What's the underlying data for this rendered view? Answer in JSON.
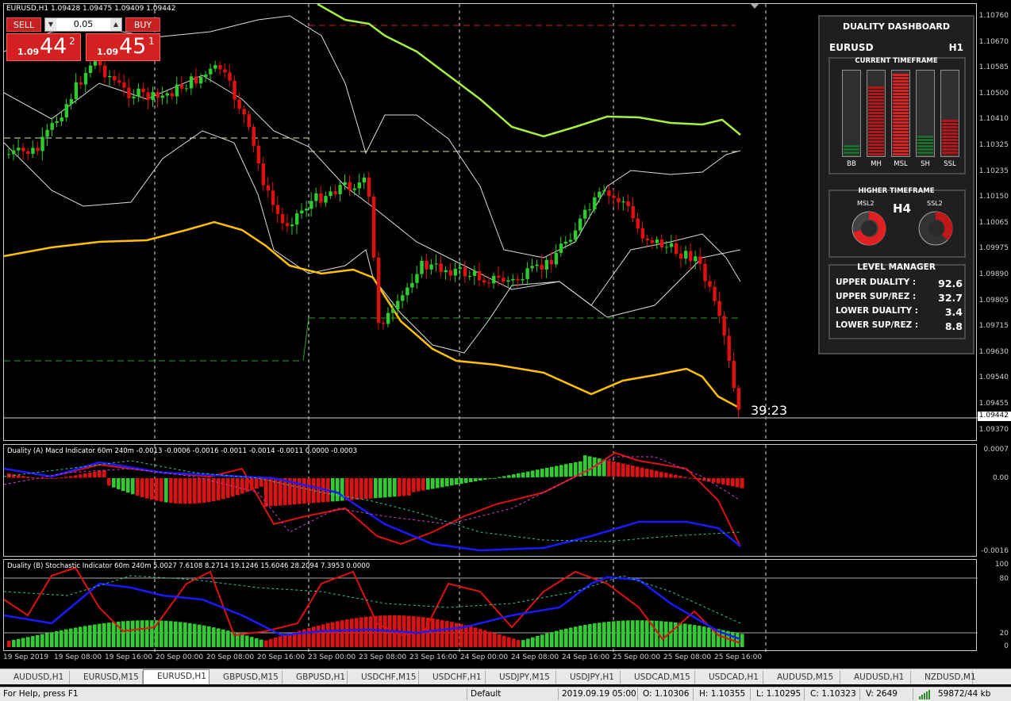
{
  "symbol_title": "EURUSD,H1  1.09428 1.09475 1.09409 1.09442",
  "trade_panel": {
    "sell_label": "SELL",
    "buy_label": "BUY",
    "lot": "0.05",
    "bid_small": "1.09",
    "bid_big": "44",
    "bid_sup": "2",
    "ask_small": "1.09",
    "ask_big": "45",
    "ask_sup": "1",
    "down_arrow": "▼",
    "up_arrow": "▲"
  },
  "countdown": "39:23",
  "price_axis": {
    "main": [
      "1.10760",
      "1.10670",
      "1.10585",
      "1.10500",
      "1.10410",
      "1.10325",
      "1.10235",
      "1.10150",
      "1.10065",
      "1.09975",
      "1.09890",
      "1.09805",
      "1.09715",
      "1.09630",
      "1.09540",
      "1.09455",
      "1.09370"
    ],
    "current_price": "1.09442",
    "macd": [
      "0.0007",
      "0.00",
      "-0.0016"
    ],
    "stoch": [
      "100",
      "80",
      "20",
      "0"
    ]
  },
  "time_axis": [
    "19 Sep 2019",
    "19 Sep 08:00",
    "19 Sep 16:00",
    "20 Sep 00:00",
    "20 Sep 08:00",
    "20 Sep 16:00",
    "23 Sep 00:00",
    "23 Sep 08:00",
    "23 Sep 16:00",
    "24 Sep 00:00",
    "24 Sep 08:00",
    "24 Sep 16:00",
    "25 Sep 00:00",
    "25 Sep 08:00",
    "25 Sep 16:00"
  ],
  "indicators": {
    "macd_title": "Duality (A) Macd Indicator 60m 240m  -0.0013 -0.0006 -0.0016 -0.0011 -0.0014 -0.0011 0.0000 -0.0003",
    "stoch_title": "Duality (B) Stochastic Indicator 60m 240m  5.0027 7.6108 8.2714 19.1246 15.6046 28.2094 7.3953 0.0000"
  },
  "dashboard": {
    "title": "DUALITY DASHBOARD",
    "symbol": "EURUSD",
    "timeframe": "H1",
    "current_tf_label": "CURRENT TIMEFRAME",
    "bars": [
      {
        "label": "BB",
        "level": 0.12,
        "color": "#1e6b2e"
      },
      {
        "label": "MH",
        "level": 0.82,
        "color": "#b01818"
      },
      {
        "label": "MSL",
        "level": 0.97,
        "color": "#d82020"
      },
      {
        "label": "SH",
        "level": 0.24,
        "color": "#1e6b2e"
      },
      {
        "label": "SSL",
        "level": 0.42,
        "color": "#b01818"
      }
    ],
    "higher_tf_label": "HIGHER TIMEFRAME",
    "gauge_left_label": "MSL2",
    "gauge_right_label": "SSL2",
    "higher_tf": "H4",
    "level_manager_label": "LEVEL MANAGER",
    "levels": [
      {
        "label": "UPPER DUALITY  :",
        "value": "92.6"
      },
      {
        "label": "UPPER SUP/REZ  :",
        "value": "32.7"
      },
      {
        "label": "LOWER DUALITY  :",
        "value": "3.4"
      },
      {
        "label": "LOWER SUP/REZ  :",
        "value": "8.8"
      }
    ]
  },
  "tabs": [
    "AUDUSD,H1",
    "EURUSD,M15",
    "EURUSD,H1",
    "GBPUSD,M15",
    "GBPUSD,H1",
    "USDCHF,M15",
    "USDCHF,H1",
    "USDJPY,M15",
    "USDJPY,H1",
    "USDCAD,M15",
    "USDCAD,H1",
    "AUDUSD,M15",
    "AUDUSD,H1",
    "NZDUSD,M1"
  ],
  "active_tab": "EURUSD,H1",
  "status": {
    "help": "For Help, press F1",
    "profile": "Default",
    "datetime": "2019.09.19 05:00",
    "open": "O: 1.10306",
    "high": "H: 1.10355",
    "low": "L: 1.10295",
    "close": "C: 1.10323",
    "volume": "V: 2649",
    "traffic": "59872/44 kb"
  },
  "colors": {
    "bull": "#2ecc2e",
    "bear": "#e01010",
    "ma_yellow": "#ffc000",
    "ma_green": "#a8f040",
    "macd_blue": "#1a1aff"
  }
}
